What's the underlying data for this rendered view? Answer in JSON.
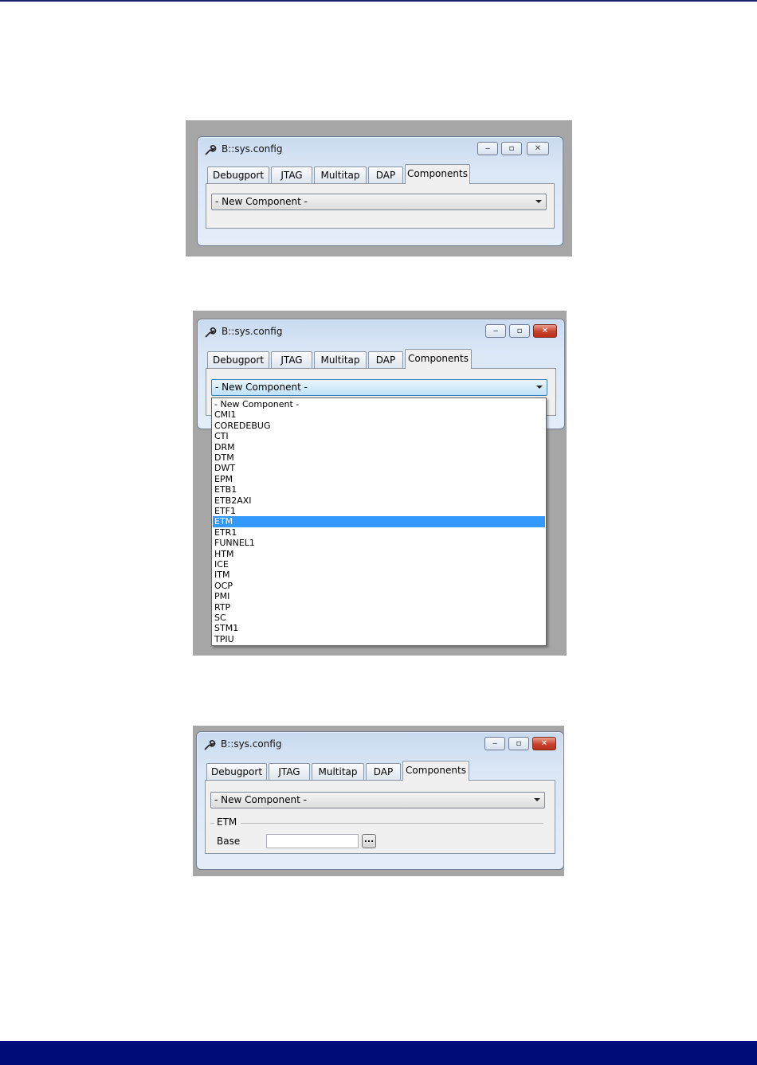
{
  "window_title": "B::sys.config",
  "tabs": [
    "Debugport",
    "JTAG",
    "Multitap",
    "DAP",
    "Components"
  ],
  "active_tab": "Components",
  "window_controls": {
    "minimize": "‒",
    "maximize": "▫",
    "close": "✕"
  },
  "combo_value": "- New Component -",
  "dropdown_options": [
    "- New Component -",
    "CMI1",
    "COREDEBUG",
    "CTI",
    "DRM",
    "DTM",
    "DWT",
    "EPM",
    "ETB1",
    "ETB2AXI",
    "ETF1",
    "ETM",
    "ETR1",
    "FUNNEL1",
    "HTM",
    "ICE",
    "ITM",
    "OCP",
    "PMI",
    "RTP",
    "SC",
    "STM1",
    "TPIU"
  ],
  "dropdown_selected": "ETM",
  "etm_group": {
    "title": "ETM",
    "base_label": "Base",
    "base_value": "",
    "browse_label": "..."
  },
  "colors": {
    "footer_bar": "#000c7a",
    "selection": "#3399ff",
    "screenshot_frame": "#a6a6a6"
  }
}
